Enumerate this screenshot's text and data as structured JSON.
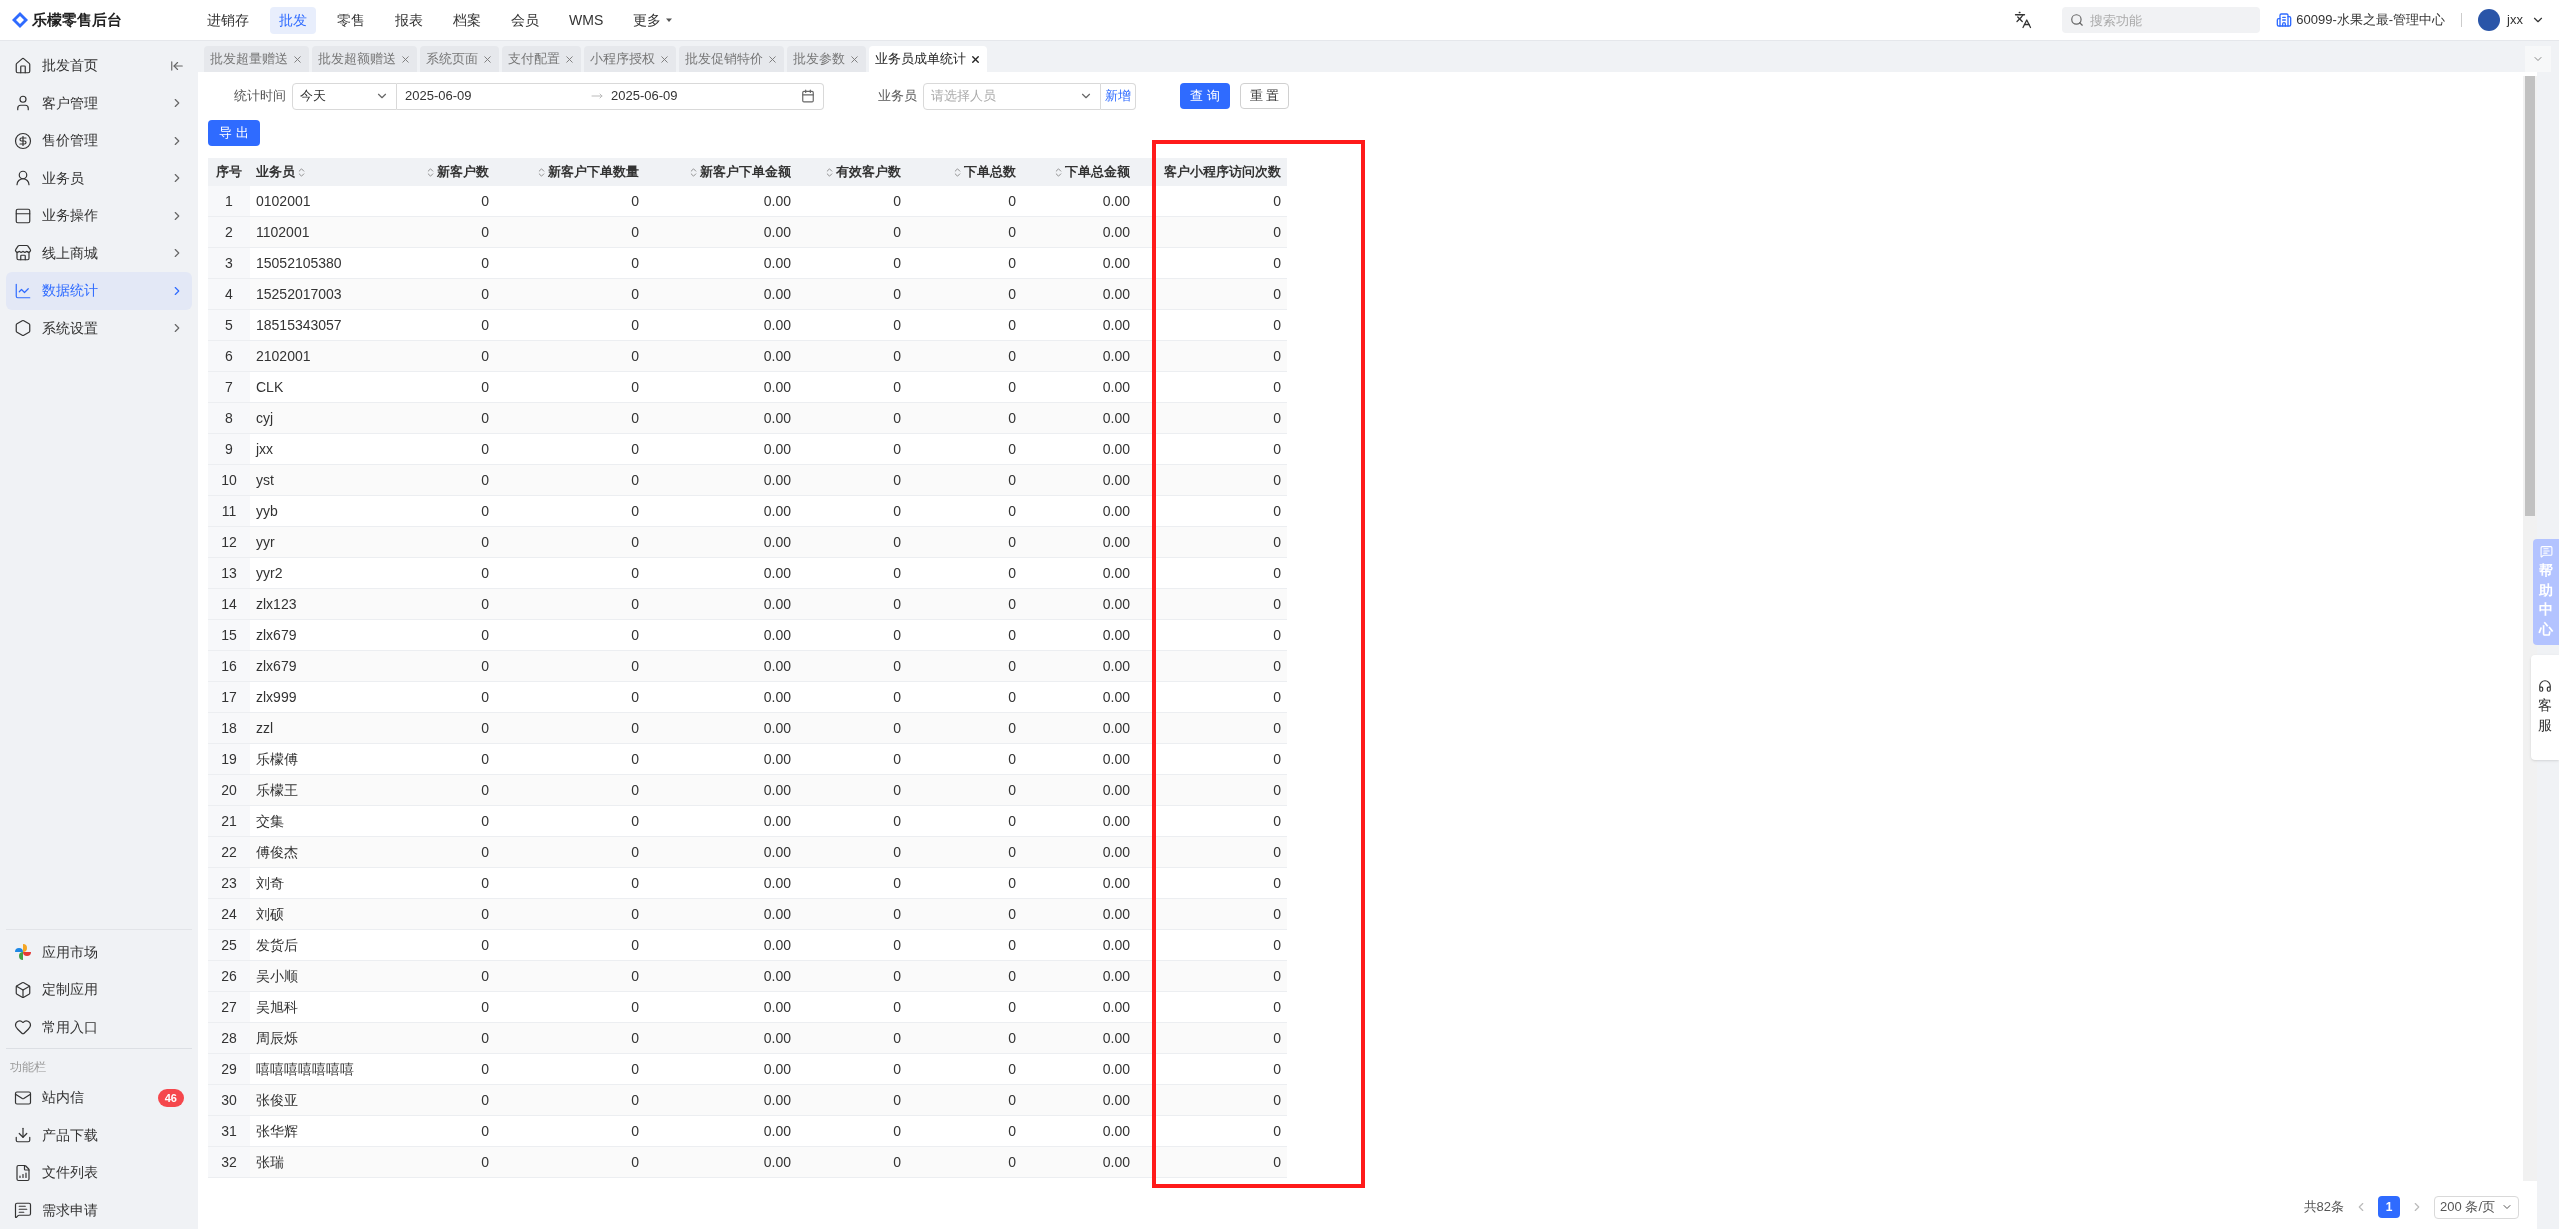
{
  "brand": "乐檬零售后台",
  "nav": [
    {
      "label": "进销存",
      "selected": false
    },
    {
      "label": "批发",
      "selected": true
    },
    {
      "label": "零售",
      "selected": false
    },
    {
      "label": "报表",
      "selected": false
    },
    {
      "label": "档案",
      "selected": false
    },
    {
      "label": "会员",
      "selected": false
    },
    {
      "label": "WMS",
      "selected": false
    },
    {
      "label": "更多",
      "selected": false,
      "dropdown": true
    }
  ],
  "search": {
    "placeholder": "搜索功能"
  },
  "store": "60099-水果之最-管理中心",
  "user": "jxx",
  "sidebar": {
    "items": [
      {
        "label": "批发首页",
        "selected": false,
        "collapse": true
      },
      {
        "label": "客户管理",
        "selected": false
      },
      {
        "label": "售价管理",
        "selected": false
      },
      {
        "label": "业务员",
        "selected": false
      },
      {
        "label": "业务操作",
        "selected": false
      },
      {
        "label": "线上商城",
        "selected": false
      },
      {
        "label": "数据统计",
        "selected": true
      },
      {
        "label": "系统设置",
        "selected": false
      }
    ],
    "bottom_items": [
      {
        "label": "应用市场"
      },
      {
        "label": "定制应用"
      },
      {
        "label": "常用入口"
      }
    ],
    "section_label": "功能栏",
    "tools": [
      {
        "label": "站内信",
        "badge": "46"
      },
      {
        "label": "产品下载"
      },
      {
        "label": "文件列表"
      },
      {
        "label": "需求申请"
      }
    ]
  },
  "tabs": [
    {
      "label": "批发超量赠送",
      "selected": false
    },
    {
      "label": "批发超额赠送",
      "selected": false
    },
    {
      "label": "系统页面",
      "selected": false
    },
    {
      "label": "支付配置",
      "selected": false
    },
    {
      "label": "小程序授权",
      "selected": false
    },
    {
      "label": "批发促销特价",
      "selected": false
    },
    {
      "label": "批发参数",
      "selected": false
    },
    {
      "label": "业务员成单统计",
      "selected": true
    }
  ],
  "filters": {
    "time_label": "统计时间",
    "period": "今天",
    "date_from": "2025-06-09",
    "date_to": "2025-06-09",
    "staff_label": "业务员",
    "staff_placeholder": "请选择人员",
    "add_link": "新增",
    "query_button": "查 询",
    "reset_button": "重 置",
    "export_button": "导 出"
  },
  "table": {
    "columns": [
      {
        "label": "序号",
        "sortable": false
      },
      {
        "label": "业务员",
        "sortable": true
      },
      {
        "label": "新客户数",
        "sortable": true
      },
      {
        "label": "新客户下单数量",
        "sortable": true
      },
      {
        "label": "新客户下单金额",
        "sortable": true
      },
      {
        "label": "有效客户数",
        "sortable": true
      },
      {
        "label": "下单总数",
        "sortable": true
      },
      {
        "label": "下单总金额",
        "sortable": true
      },
      {
        "label": "客户小程序访问次数",
        "sortable": false
      }
    ],
    "rows": [
      [
        "1",
        "0102001",
        "0",
        "0",
        "0.00",
        "0",
        "0",
        "0.00",
        "0"
      ],
      [
        "2",
        "1102001",
        "0",
        "0",
        "0.00",
        "0",
        "0",
        "0.00",
        "0"
      ],
      [
        "3",
        "15052105380",
        "0",
        "0",
        "0.00",
        "0",
        "0",
        "0.00",
        "0"
      ],
      [
        "4",
        "15252017003",
        "0",
        "0",
        "0.00",
        "0",
        "0",
        "0.00",
        "0"
      ],
      [
        "5",
        "18515343057",
        "0",
        "0",
        "0.00",
        "0",
        "0",
        "0.00",
        "0"
      ],
      [
        "6",
        "2102001",
        "0",
        "0",
        "0.00",
        "0",
        "0",
        "0.00",
        "0"
      ],
      [
        "7",
        "CLK",
        "0",
        "0",
        "0.00",
        "0",
        "0",
        "0.00",
        "0"
      ],
      [
        "8",
        "cyj",
        "0",
        "0",
        "0.00",
        "0",
        "0",
        "0.00",
        "0"
      ],
      [
        "9",
        "jxx",
        "0",
        "0",
        "0.00",
        "0",
        "0",
        "0.00",
        "0"
      ],
      [
        "10",
        "yst",
        "0",
        "0",
        "0.00",
        "0",
        "0",
        "0.00",
        "0"
      ],
      [
        "11",
        "yyb",
        "0",
        "0",
        "0.00",
        "0",
        "0",
        "0.00",
        "0"
      ],
      [
        "12",
        "yyr",
        "0",
        "0",
        "0.00",
        "0",
        "0",
        "0.00",
        "0"
      ],
      [
        "13",
        "yyr2",
        "0",
        "0",
        "0.00",
        "0",
        "0",
        "0.00",
        "0"
      ],
      [
        "14",
        "zlx123",
        "0",
        "0",
        "0.00",
        "0",
        "0",
        "0.00",
        "0"
      ],
      [
        "15",
        "zlx679",
        "0",
        "0",
        "0.00",
        "0",
        "0",
        "0.00",
        "0"
      ],
      [
        "16",
        "zlx679",
        "0",
        "0",
        "0.00",
        "0",
        "0",
        "0.00",
        "0"
      ],
      [
        "17",
        "zlx999",
        "0",
        "0",
        "0.00",
        "0",
        "0",
        "0.00",
        "0"
      ],
      [
        "18",
        "zzl",
        "0",
        "0",
        "0.00",
        "0",
        "0",
        "0.00",
        "0"
      ],
      [
        "19",
        "乐檬傅",
        "0",
        "0",
        "0.00",
        "0",
        "0",
        "0.00",
        "0"
      ],
      [
        "20",
        "乐檬王",
        "0",
        "0",
        "0.00",
        "0",
        "0",
        "0.00",
        "0"
      ],
      [
        "21",
        "交集",
        "0",
        "0",
        "0.00",
        "0",
        "0",
        "0.00",
        "0"
      ],
      [
        "22",
        "傅俊杰",
        "0",
        "0",
        "0.00",
        "0",
        "0",
        "0.00",
        "0"
      ],
      [
        "23",
        "刘奇",
        "0",
        "0",
        "0.00",
        "0",
        "0",
        "0.00",
        "0"
      ],
      [
        "24",
        "刘硕",
        "0",
        "0",
        "0.00",
        "0",
        "0",
        "0.00",
        "0"
      ],
      [
        "25",
        "发货后",
        "0",
        "0",
        "0.00",
        "0",
        "0",
        "0.00",
        "0"
      ],
      [
        "26",
        "吴小顺",
        "0",
        "0",
        "0.00",
        "0",
        "0",
        "0.00",
        "0"
      ],
      [
        "27",
        "吴旭科",
        "0",
        "0",
        "0.00",
        "0",
        "0",
        "0.00",
        "0"
      ],
      [
        "28",
        "周辰烁",
        "0",
        "0",
        "0.00",
        "0",
        "0",
        "0.00",
        "0"
      ],
      [
        "29",
        "嘻嘻嘻嘻嘻嘻嘻",
        "0",
        "0",
        "0.00",
        "0",
        "0",
        "0.00",
        "0"
      ],
      [
        "30",
        "张俊亚",
        "0",
        "0",
        "0.00",
        "0",
        "0",
        "0.00",
        "0"
      ],
      [
        "31",
        "张华辉",
        "0",
        "0",
        "0.00",
        "0",
        "0",
        "0.00",
        "0"
      ],
      [
        "32",
        "张瑞",
        "0",
        "0",
        "0.00",
        "0",
        "0",
        "0.00",
        "0"
      ]
    ]
  },
  "highlight_box": true,
  "pagination": {
    "total": "共82条",
    "pages": [
      {
        "label": "1",
        "selected": true
      }
    ],
    "page_size": "200 条/页"
  },
  "help": {
    "help_center": "帮助中心",
    "service": "客服"
  }
}
